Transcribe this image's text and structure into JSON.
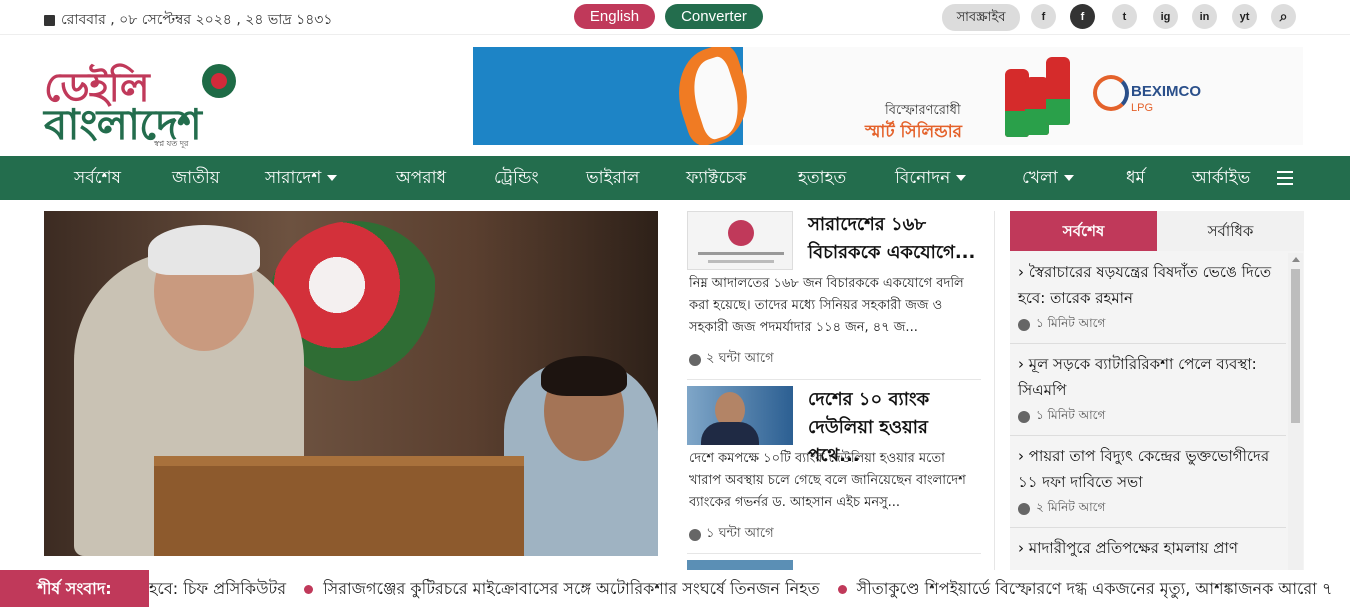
{
  "topbar": {
    "date": "রোববার , ০৮ সেপ্টেম্বর ২০২৪ , ২৪ ভাদ্র ১৪৩১",
    "english_label": "English",
    "converter_label": "Converter",
    "subscribe_label": "সাবস্ক্রাইব",
    "social": [
      "f",
      "f",
      "t",
      "ig",
      "in",
      "yt"
    ],
    "colors": {
      "brand_red": "#c0395a",
      "brand_green": "#236d4d"
    }
  },
  "logo": {
    "line1": "ডেইলি",
    "line2": "বাংলাদেশ",
    "tagline": "স্বপ্ন যত দূর"
  },
  "ad": {
    "text_small": "বিস্ফোরণরোধী",
    "text_big": "স্মার্ট সিলিন্ডার",
    "brand": "BEXIMCO",
    "brand_sub": "LPG"
  },
  "nav": {
    "items": [
      "সর্বশেষ",
      "জাতীয়",
      "সারাদেশ",
      "অপরাধ",
      "ট্রেন্ডিং",
      "ভাইরাল",
      "ফ্যাক্টচেক",
      "হতাহত",
      "বিনোদন",
      "খেলা",
      "ধর্ম",
      "আর্কাইভ"
    ]
  },
  "hero": {
    "title_fragment": ""
  },
  "news": [
    {
      "title": "সারাদেশের ১৬৮ বিচারককে একযোগে...",
      "excerpt": "নিম্ন আদালতের ১৬৮ জন বিচারককে একযোগে বদলি করা হয়েছে। তাদের মধ্যে সিনিয়র সহকারী জজ ও সহকারী জজ পদমর্যাদার ১১৪ জন, ৪৭ জ...",
      "time": "২ ঘন্টা আগে"
    },
    {
      "title": "দেশের ১০ ব্যাংক দেউলিয়া হওয়ার পথে...",
      "excerpt": "দেশে কমপক্ষে ১০টি ব্যাংক দেউলিয়া হওয়ার মতো খারাপ অবস্থায় চলে গেছে বলে জানিয়েছেন বাংলাদেশ ব্যাংকের গভর্নর ড. আহসান এইচ মনসু...",
      "time": "১ ঘন্টা আগে"
    }
  ],
  "sidebar": {
    "tab_latest": "সর্বশেষ",
    "tab_most": "সর্বাধিক",
    "items": [
      {
        "title": "স্বৈরাচারের ষড়যন্ত্রের বিষদাঁত ভেঙে দিতে হবে: তারেক রহমান",
        "time": "১ মিনিট আগে"
      },
      {
        "title": "মূল সড়কে ব্যাটারিরিকশা পেলে ব্যবস্থা: সিএমপি",
        "time": "১ মিনিট আগে"
      },
      {
        "title": "পায়রা তাপ বিদ্যুৎ কেন্দ্রের ভুক্তভোগীদের ১১ দফা দাবিতে সভা",
        "time": "২ মিনিট আগে"
      },
      {
        "title": "মাদারীপুরে প্রতিপক্ষের হামলায় প্রাণ",
        "time": ""
      }
    ]
  },
  "ticker": {
    "label": "শীর্ষ সংবাদ:",
    "items": [
      "হবে: চিফ প্রসিকিউটর",
      "সিরাজগঞ্জের কুটিরচরে মাইক্রোবাসের সঙ্গে অটোরিকশার সংঘর্ষে তিনজন নিহত",
      "সীতাকুণ্ডে শিপইয়ার্ডে বিস্ফোরণে দগ্ধ একজনের মৃত্যু, আশঙ্কাজনক আরো ৭"
    ]
  }
}
